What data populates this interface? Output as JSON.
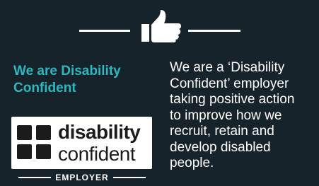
{
  "colors": {
    "background": "#17232a",
    "title_accent": "#2fb7c0",
    "text": "#ffffff",
    "logo_dark": "#1b1b1b"
  },
  "header": {
    "icon": "thumbs-up-icon"
  },
  "section": {
    "title_line1": "We are Disability",
    "title_line2": "Confident",
    "description_lines": [
      "We are a ‘Disability",
      "Confident’ employer",
      "taking positive action",
      "to improve how we",
      "recruit, retain and",
      "develop disabled",
      "people."
    ]
  },
  "logo": {
    "word1": "disability",
    "word2": "confident",
    "badge": "EMPLOYER"
  }
}
